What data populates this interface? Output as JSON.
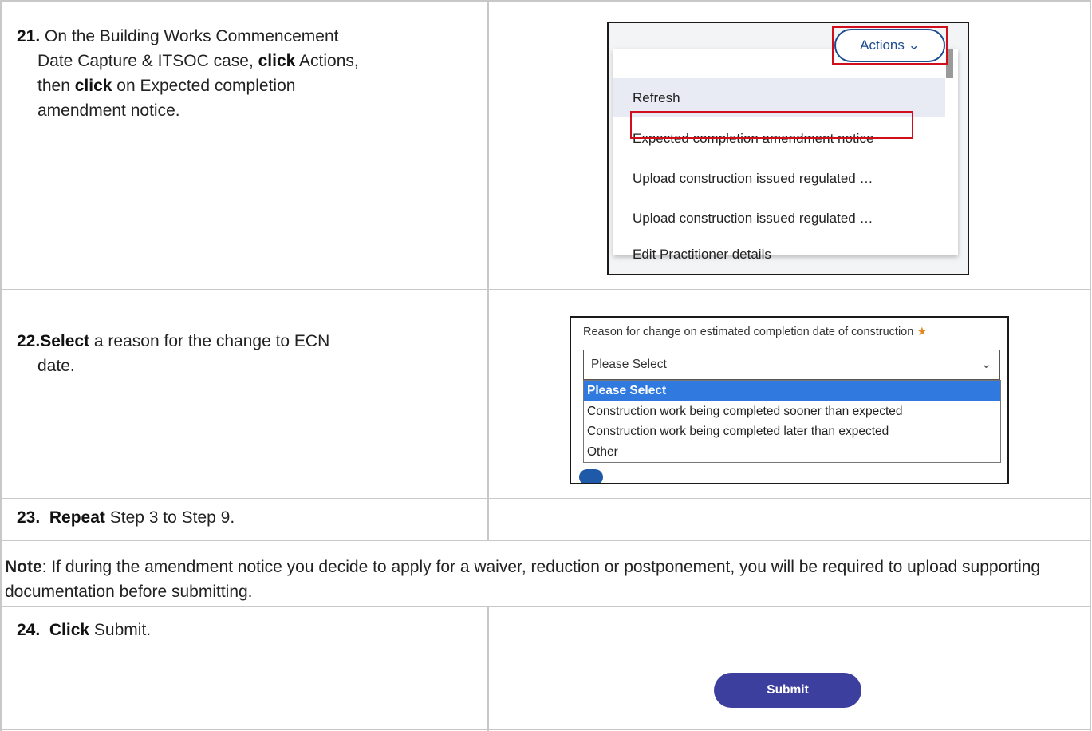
{
  "steps": [
    {
      "num": "21.",
      "line1_prefix": "On the Building Works Commencement",
      "line2": "Date Capture & ITSOC case,",
      "line2_bold": "click",
      "line2_suffix": "Actions,",
      "line3_prefix": "then",
      "line3_bold": "click",
      "line3_suffix": "on Expected completion",
      "line4": "amendment notice."
    },
    {
      "num": "22.",
      "bold": "Select",
      "line1_suffix": "a reason for the change to ECN",
      "line2": "date."
    },
    {
      "num": "23.",
      "bold": "Repeat",
      "suffix": "Step 3 to Step 9."
    },
    {
      "num": "24.",
      "bold": "Click",
      "suffix": "Submit."
    }
  ],
  "note": {
    "label": "Note",
    "text": ":  If during the amendment notice you decide to apply for a waiver, reduction or postponement, you will be required to upload supporting documentation before submitting."
  },
  "actions_menu": {
    "button_label": "Actions",
    "items": [
      "Refresh",
      "Expected completion amendment notice",
      "Upload construction issued regulated …",
      "Upload construction issued regulated …",
      "Edit Practitioner details"
    ]
  },
  "reason_select": {
    "label": "Reason for change on estimated completion date of construction",
    "required_mark": "★",
    "current_value": "Please Select",
    "options": [
      "Please Select",
      "Construction work being completed sooner than expected",
      "Construction work being completed later than expected",
      "Other"
    ]
  },
  "submit_label": "Submit",
  "colors": {
    "highlight_red": "#d10f1c",
    "selected_option": "#2f79df",
    "submit_bg": "#3d3f9f",
    "actions_border": "#1d4d8f"
  }
}
